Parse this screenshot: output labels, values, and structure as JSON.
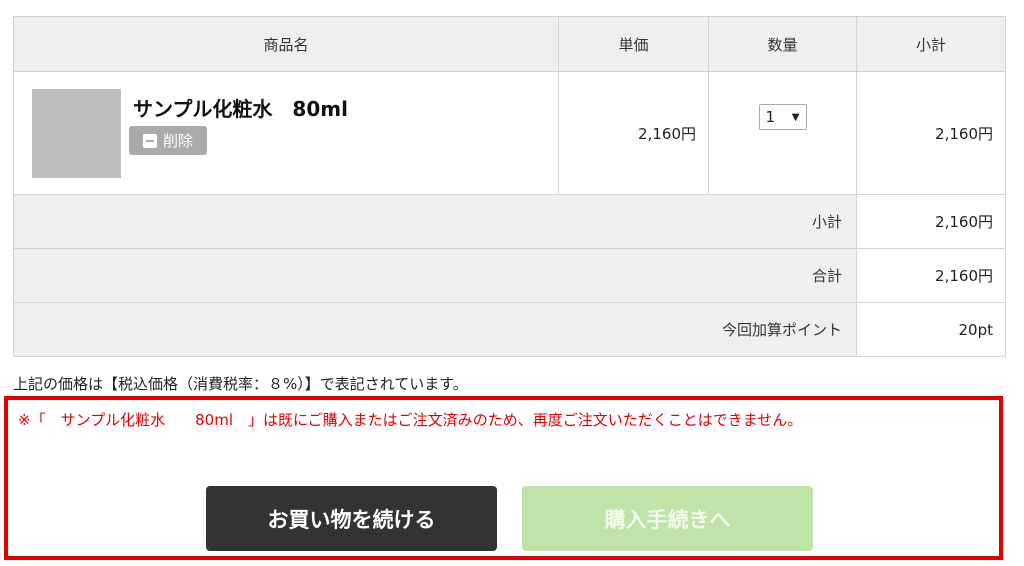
{
  "table": {
    "headers": [
      "商品名",
      "単価",
      "数量",
      "小計"
    ],
    "item": {
      "name": "サンプル化粧水　80ml",
      "delete_label": "削除",
      "unit_price": "2,160円",
      "quantity": "1",
      "subtotal": "2,160円"
    },
    "summary": [
      {
        "label": "小計",
        "value": "2,160円"
      },
      {
        "label": "合計",
        "value": "2,160円"
      },
      {
        "label": "今回加算ポイント",
        "value": "20pt"
      }
    ]
  },
  "tax_note": "上記の価格は【税込価格（消費税率：８%）】で表記されています。",
  "warning": "※「　サンプル化粧水　　80ml　」は既にご購入またはご注文済みのため、再度ご注文いただくことはできません。",
  "buttons": {
    "continue_shopping": "お買い物を続ける",
    "checkout": "購入手続きへ"
  },
  "colors": {
    "warning_red": "#e30000",
    "dark_button": "#333333",
    "checkout_disabled": "#bfe3a9"
  }
}
